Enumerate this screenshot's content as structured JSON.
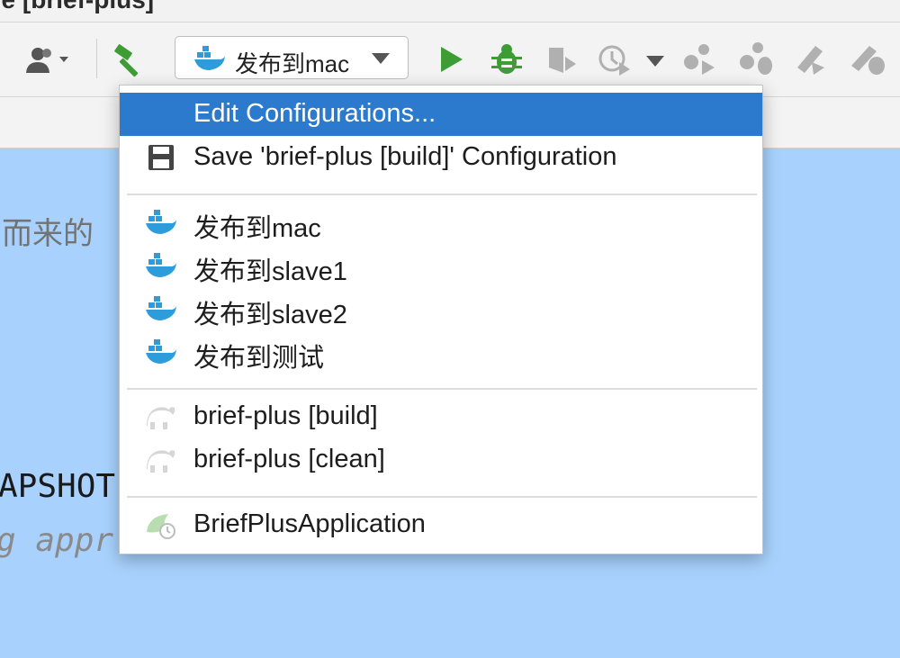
{
  "window": {
    "title_fragment": "lle [brief-plus]"
  },
  "toolbar": {
    "run_config_label": "发布到mac",
    "icons": [
      "user-icon",
      "hammer-icon",
      "docker-icon",
      "run-icon",
      "debug-icon",
      "coverage-icon",
      "profile-icon",
      "chevron-down-icon",
      "group-icon",
      "group-debug-icon",
      "deploy-icon",
      "deploy-debug-icon"
    ]
  },
  "editor": {
    "fragment_1": "而来的",
    "fragment_2": "APSHOT",
    "fragment_3": "g  appr"
  },
  "menu": {
    "edit_configurations": "Edit Configurations...",
    "save_configuration": "Save 'brief-plus [build]' Configuration",
    "docker_items": [
      "发布到mac",
      "发布到slave1",
      "发布到slave2",
      "发布到测试"
    ],
    "gradle_items": [
      "brief-plus [build]",
      "brief-plus [clean]"
    ],
    "spring_items": [
      "BriefPlusApplication"
    ]
  },
  "colors": {
    "selection": "#2b7ace",
    "editor_bg": "#a8d2fd",
    "docker_blue": "#2d9cdb",
    "run_green": "#3e9c35"
  }
}
